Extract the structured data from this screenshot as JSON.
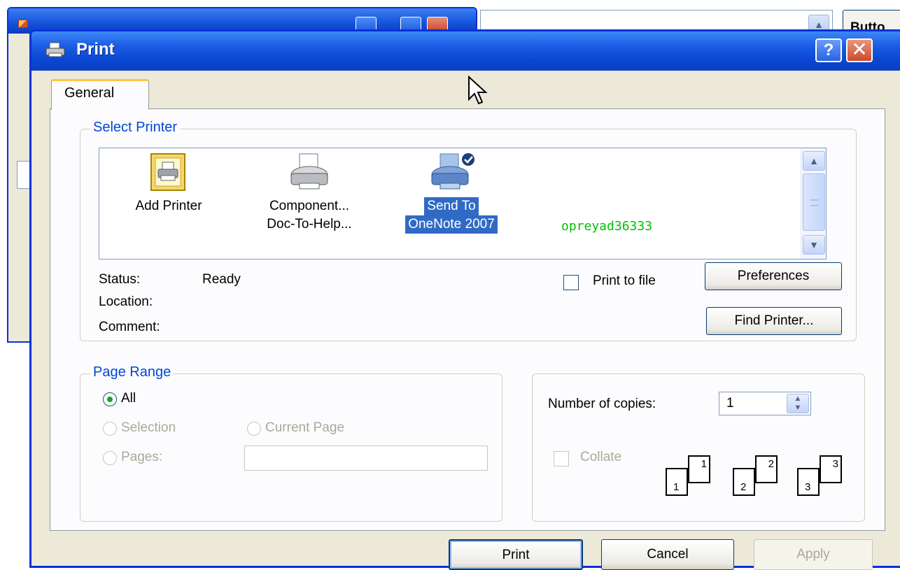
{
  "background_window": {
    "right_button_label": "Butto",
    "scroll_up_glyph": "▲"
  },
  "dialog": {
    "title": "Print",
    "help_glyph": "?",
    "close_glyph": "✕",
    "tab_general": "General",
    "select_printer": {
      "group_label": "Select Printer",
      "printers": [
        {
          "line1": "Add Printer",
          "line2": "",
          "icon": "add-printer-icon",
          "selected": false
        },
        {
          "line1": "Component...",
          "line2": "Doc-To-Help...",
          "icon": "printer-icon",
          "selected": false
        },
        {
          "line1": "Send To",
          "line2": "OneNote 2007",
          "icon": "onenote-printer-icon",
          "selected": true
        }
      ],
      "extra_label": "opreyad36333",
      "scroll_up": "▲",
      "scroll_down": "▼",
      "status_label": "Status:",
      "status_value": "Ready",
      "location_label": "Location:",
      "comment_label": "Comment:",
      "print_to_file_label": "Print to file",
      "preferences_button": "Preferences",
      "find_printer_button": "Find Printer..."
    },
    "page_range": {
      "group_label": "Page Range",
      "all_label": "All",
      "selection_label": "Selection",
      "current_page_label": "Current Page",
      "pages_label": "Pages:",
      "pages_value": ""
    },
    "copies": {
      "number_of_copies_label": "Number of copies:",
      "number_of_copies_value": "1",
      "collate_label": "Collate",
      "collate_groups": [
        {
          "back": "1",
          "front": "1"
        },
        {
          "back": "2",
          "front": "2"
        },
        {
          "back": "3",
          "front": "3"
        }
      ]
    },
    "buttons": {
      "print": "Print",
      "cancel": "Cancel",
      "apply": "Apply"
    }
  },
  "colors": {
    "titlebar": "#0b47d2",
    "group_label": "#0046d5",
    "selection": "#316ac5",
    "extra_label": "#00c000"
  }
}
